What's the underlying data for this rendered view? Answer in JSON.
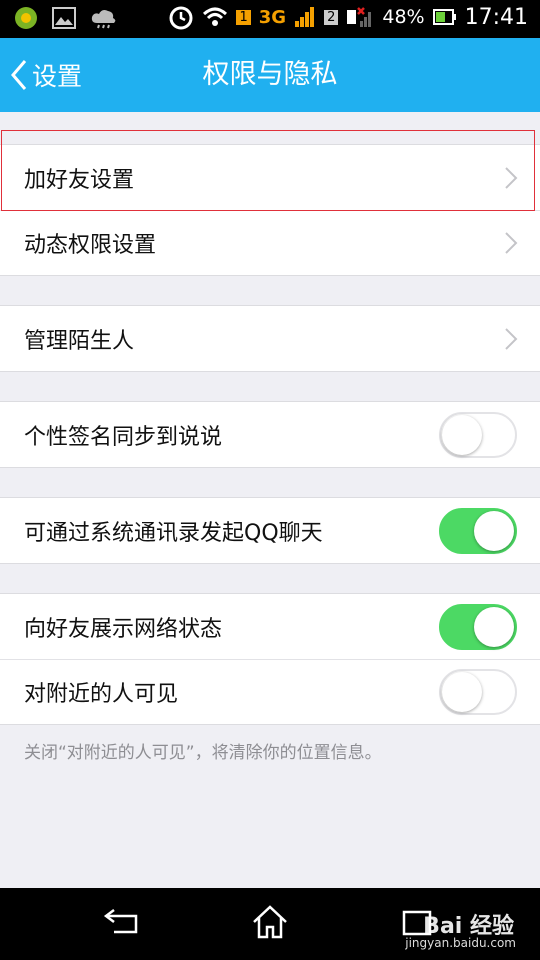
{
  "status_bar": {
    "network_type": "3G",
    "sim_badge_1": "1",
    "sim_badge_2": "2",
    "battery_percent": "48%",
    "time": "17:41"
  },
  "title_bar": {
    "back_label": "设置",
    "title": "权限与隐私"
  },
  "settings": {
    "group1": {
      "items": [
        {
          "label": "加好友设置"
        },
        {
          "label": "动态权限设置"
        }
      ]
    },
    "group2": {
      "items": [
        {
          "label": "管理陌生人"
        }
      ]
    },
    "group3": {
      "items": [
        {
          "label": "个性签名同步到说说",
          "toggle_on": false
        }
      ]
    },
    "group4": {
      "items": [
        {
          "label": "可通过系统通讯录发起QQ聊天",
          "toggle_on": true
        }
      ]
    },
    "group5": {
      "items": [
        {
          "label": "向好友展示网络状态",
          "toggle_on": true
        },
        {
          "label": "对附近的人可见",
          "toggle_on": false
        }
      ]
    },
    "footnote": "关闭“对附近的人可见”，将清除你的位置信息。"
  },
  "colors": {
    "title_bar": "#20b0f0",
    "toggle_on": "#4cd964",
    "highlight": "#e0303a"
  },
  "watermark": {
    "brand": "Bai 经验",
    "url": "jingyan.baidu.com"
  }
}
